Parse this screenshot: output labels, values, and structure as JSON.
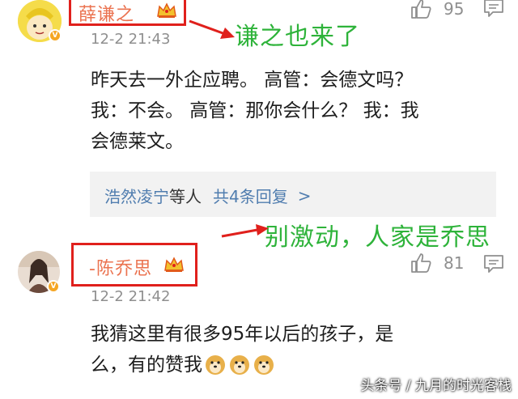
{
  "comments": [
    {
      "username": "薛谦之",
      "timestamp": "12-2 21:43",
      "likes": "95",
      "body_lines": [
        "昨天去一外企应聘。 高管：会德文吗？",
        "我：不会。 高管：那你会什么？ 我：我",
        "会德莱文。"
      ],
      "reply_summary": {
        "names": "浩然凌宁",
        "suffix": "等人",
        "count_text": "共4条回复",
        "chevron": ">"
      }
    },
    {
      "username": "-陈乔思",
      "timestamp": "12-2 21:42",
      "likes": "81",
      "body_lines": [
        "我猜这里有很多95年以后的孩子，是",
        "么，有的赞我"
      ]
    }
  ],
  "annotations": {
    "first": "谦之也来了",
    "second": "别激动，人家是乔思"
  },
  "watermark": "头条号 / 九月的时光客栈",
  "colors": {
    "username": "#eb7350",
    "annotation": "#2eb33a",
    "highlight_box": "#e0201c",
    "link": "#507daf"
  },
  "icons": [
    "thumbs-up-icon",
    "comment-icon",
    "crown-icon",
    "verified-badge-icon",
    "doge-emoji-icon"
  ]
}
